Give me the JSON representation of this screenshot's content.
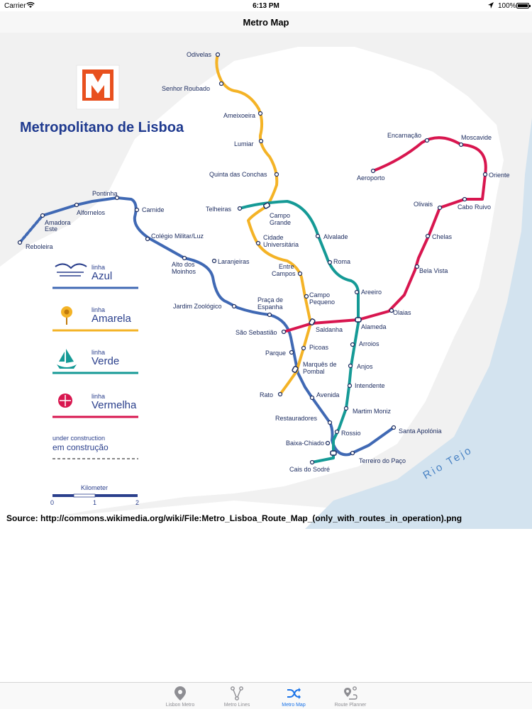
{
  "status_bar": {
    "carrier": "Carrier",
    "time": "6:13 PM",
    "battery_percent": "100%",
    "battery_level": 1.0
  },
  "nav": {
    "title": "Metro Map"
  },
  "map": {
    "brand": "Metropolitano de Lisboa",
    "river": "Rio Tejo",
    "legend": {
      "linha": "linha",
      "azul": "Azul",
      "amarela": "Amarela",
      "verde": "Verde",
      "vermelha": "Vermelha",
      "under_construction_en": "under construction",
      "under_construction_pt": "em construção",
      "scale_title": "Kilometer",
      "scale_0": "0",
      "scale_1": "1",
      "scale_2": "2"
    },
    "colors": {
      "azul": "#4069b4",
      "amarela": "#f4b326",
      "verde": "#159a96",
      "vermelha": "#d8164f",
      "land": "#ffffff",
      "surround": "#f2f2f2",
      "water": "#d3e3ef"
    },
    "stations": {
      "odivelas": "Odivelas",
      "senhor_roubado": "Senhor Roubado",
      "ameixoeira": "Ameixoeira",
      "lumiar": "Lumiar",
      "quinta_das_conchas": "Quinta das Conchas",
      "telheiras": "Telheiras",
      "campo_grande_1": "Campo",
      "campo_grande_2": "Grande",
      "cidade_universitaria_1": "Cidade",
      "cidade_universitaria_2": "Universitária",
      "alvalade": "Alvalade",
      "roma": "Roma",
      "areeiro": "Areeiro",
      "entre_campos_1": "Entre",
      "entre_campos_2": "Campos",
      "campo_pequeno_1": "Campo",
      "campo_pequeno_2": "Pequeno",
      "pontinha": "Pontinha",
      "carnide": "Carnide",
      "alfornelos": "Alfornelos",
      "amadora_este_1": "Amadora",
      "amadora_este_2": "Este",
      "reboleira": "Reboleira",
      "colegio_militar": "Colégio Militar/Luz",
      "alto_dos_moinhos_1": "Alto dos",
      "alto_dos_moinhos_2": "Moinhos",
      "laranjeiras": "Laranjeiras",
      "jardim_zoologico": "Jardim Zoológico",
      "praca_de_espanha_1": "Praça de",
      "praca_de_espanha_2": "Espanha",
      "sao_sebastiao": "São Sebastião",
      "saldanha": "Saldanha",
      "alameda": "Alameda",
      "parque": "Parque",
      "picoas": "Picoas",
      "marques_1": "Marquês de",
      "marques_2": "Pombal",
      "arroios": "Arroios",
      "anjos": "Anjos",
      "rato": "Rato",
      "avenida": "Avenida",
      "intendente": "Intendente",
      "martim_moniz": "Martim Moniz",
      "restauradores": "Restauradores",
      "rossio": "Rossio",
      "baixa_chiado": "Baixa-Chiado",
      "cais_do_sodre": "Cais do Sodré",
      "terreiro_do_paco": "Terreiro do Paço",
      "santa_apolonia": "Santa Apolónia",
      "encarnacao": "Encarnação",
      "moscavide": "Moscavide",
      "aeroporto": "Aeroporto",
      "oriente": "Oriente",
      "olivais": "Olivais",
      "cabo_ruivo": "Cabo Ruivo",
      "chelas": "Chelas",
      "bela_vista": "Bela Vista",
      "olaias": "Olaias"
    },
    "source": "Source: http://commons.wikimedia.org/wiki/File:Metro_Lisboa_Route_Map_(only_with_routes_in_operation).png"
  },
  "tabs": [
    {
      "label": "Lisbon Metro",
      "icon": "location-pin-icon",
      "active": false
    },
    {
      "label": "Metro Lines",
      "icon": "network-icon",
      "active": false
    },
    {
      "label": "Metro Map",
      "icon": "shuffle-icon",
      "active": true
    },
    {
      "label": "Route Planner",
      "icon": "route-icon",
      "active": false
    }
  ]
}
